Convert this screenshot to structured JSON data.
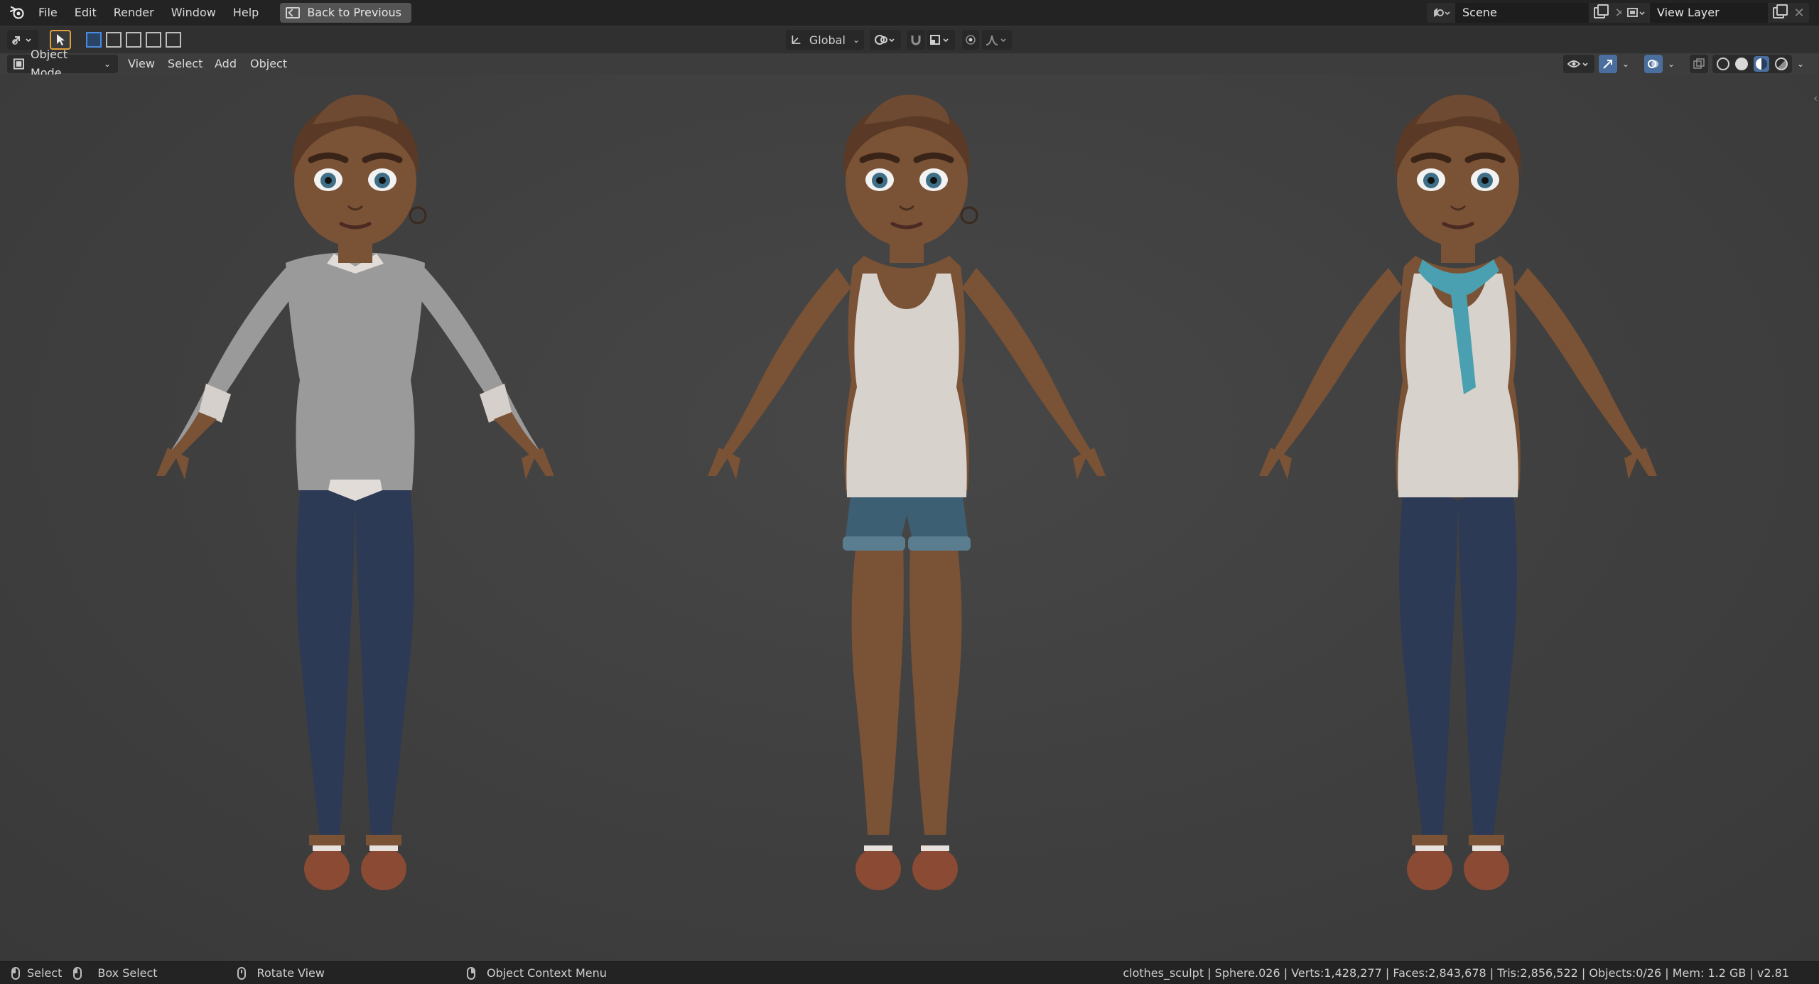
{
  "menu": {
    "items": [
      "File",
      "Edit",
      "Render",
      "Window",
      "Help"
    ],
    "back_button": "Back to Previous"
  },
  "scene": {
    "name": "Scene",
    "view_layer": "View Layer"
  },
  "tool_header": {
    "transform_orientation": "Global"
  },
  "viewport_header": {
    "mode": "Object Mode",
    "menus": [
      "View",
      "Select",
      "Add",
      "Object"
    ]
  },
  "viewport": {
    "characters": [
      {
        "outfit": "sweater-and-jeans",
        "top_color": "#9a9a9a",
        "bottom_color": "#2c3a55",
        "skin": "#7a5236",
        "scarf": false
      },
      {
        "outfit": "tank-top-and-shorts",
        "top_color": "#d8d2cc",
        "bottom_color": "#3d5f73",
        "skin": "#7a5236",
        "scarf": false
      },
      {
        "outfit": "tank-top-jeans-scarf",
        "top_color": "#d8d2cc",
        "bottom_color": "#2c3a55",
        "skin": "#7a5236",
        "scarf": true,
        "scarf_color": "#4aa0b0"
      }
    ]
  },
  "status": {
    "select": "Select",
    "box_select": "Box Select",
    "rotate_view": "Rotate View",
    "context_menu": "Object Context Menu",
    "stats": "clothes_sculpt | Sphere.026 | Verts:1,428,277 | Faces:2,843,678 | Tris:2,856,522 | Objects:0/26 | Mem: 1.2 GB | v2.81"
  },
  "colors": {
    "accent_select": "#e1a03a",
    "accent_blue": "#4a8be0",
    "shoe": "#8a4a33"
  }
}
